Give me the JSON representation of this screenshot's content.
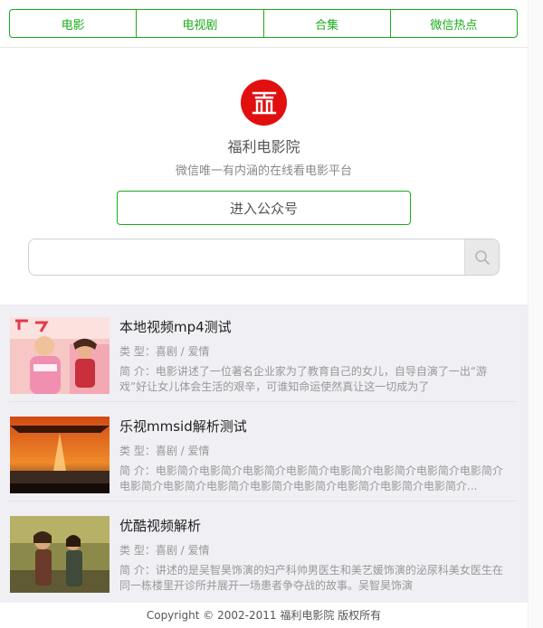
{
  "nav": {
    "items": [
      {
        "label": "电影"
      },
      {
        "label": "电视剧"
      },
      {
        "label": "合集"
      },
      {
        "label": "微信热点"
      }
    ]
  },
  "header": {
    "site_name": "福利电影院",
    "slogan": "微信唯一有内涵的在线看电影平台",
    "follow_button": "进入公众号"
  },
  "search": {
    "placeholder": "",
    "icon": "search-icon"
  },
  "movies": [
    {
      "title": "本地视频mp4测试",
      "type": "类 型：喜剧 / 爱情",
      "intro": "简 介：电影讲述了一位著名企业家为了教育自己的女儿，自导自演了一出“游戏”好让女儿体会生活的艰辛，可谁知命运使然真让这一切成为了"
    },
    {
      "title": "乐视mmsid解析测试",
      "type": "类 型：喜剧 / 爱情",
      "intro": "简 介：电影简介电影简介电影简介电影简介电影简介电影简介电影简介电影简介电影简介电影简介电影简介电影简介电影简介电影简介电影简介电影简介..."
    },
    {
      "title": "优酷视频解析",
      "type": "类 型：喜剧 / 爱情",
      "intro": "简 介：讲述的是吴智昊饰演的妇产科帅男医生和美艺媛饰演的泌尿科美女医生在同一栋楼里开诊所并展开一场患者争夺战的故事。吴智昊饰演"
    }
  ],
  "footer": {
    "copyright": "Copyright © 2002-2011 福利电影院 版权所有"
  },
  "colors": {
    "accent": "#1aac19",
    "logo_bg": "#e20f0f",
    "list_bg": "#efeff4"
  }
}
